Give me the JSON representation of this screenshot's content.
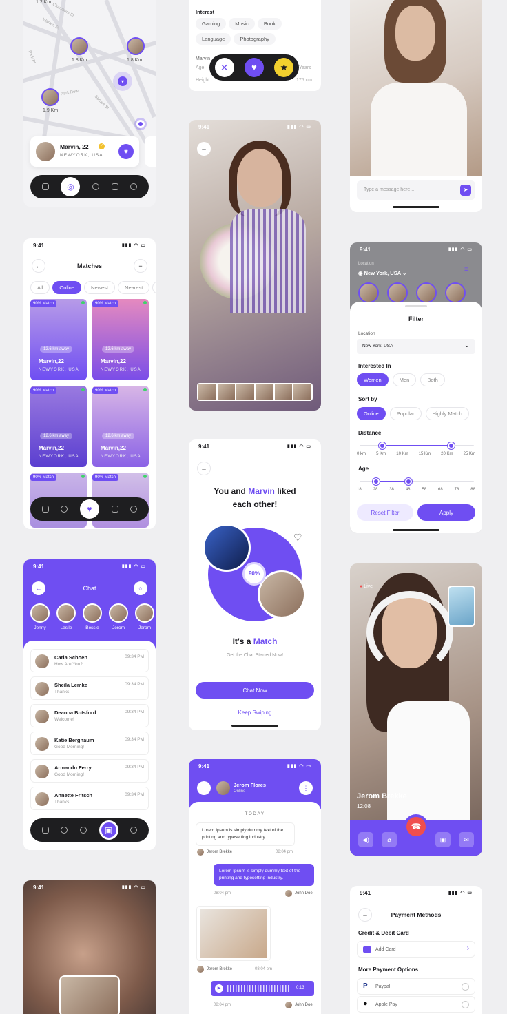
{
  "map": {
    "distances": [
      "1.2 Km",
      "1.8 Km",
      "1.8 Km",
      "1.9 Km"
    ],
    "streets": [
      "Chambers St",
      "Warren St",
      "Park Pl",
      "Park Row",
      "Spruce St"
    ],
    "profile": {
      "name": "Marvin, 22",
      "location": "NEWYORK, USA"
    }
  },
  "interest": {
    "heading": "Interest",
    "chips": [
      "Gaming",
      "Music",
      "Book",
      "Language",
      "Photography"
    ],
    "partial_labels": [
      "Marvin",
      "Age",
      "Height",
      "Years",
      "175 cm"
    ]
  },
  "message": {
    "placeholder": "Type a message here..."
  },
  "profile_photo": {
    "time": "9:41"
  },
  "matches": {
    "time": "9:41",
    "title": "Matches",
    "tabs": [
      "All",
      "Online",
      "Newest",
      "Nearest",
      "M"
    ],
    "match_badge": "90% Match",
    "distance": "12.6 km away",
    "cards": [
      {
        "name": "Marvin,22",
        "loc": "NEWYORK, USA"
      },
      {
        "name": "Marvin,22",
        "loc": "NEWYORK, USA"
      },
      {
        "name": "Marvin,22",
        "loc": "NEWYORK, USA"
      },
      {
        "name": "Marvin,22",
        "loc": "NEWYORK, USA"
      }
    ]
  },
  "filter": {
    "time": "9:41",
    "location_label": "Location",
    "location_value": "New York, USA",
    "title": "Filter",
    "location_field_label": "Location",
    "location_field_value": "New York, USA",
    "interested_label": "Interested In",
    "interested": [
      "Women",
      "Men",
      "Both"
    ],
    "sort_label": "Sort by",
    "sort": [
      "Online",
      "Popular",
      "Highly Match"
    ],
    "distance_label": "Distance",
    "distance_ticks": [
      "0 km",
      "5 Km",
      "10 Km",
      "15 Km",
      "20 Km",
      "25 Km"
    ],
    "distance_range": [
      5,
      20
    ],
    "age_label": "Age",
    "age_ticks": [
      "18",
      "28",
      "38",
      "48",
      "58",
      "68",
      "78",
      "88"
    ],
    "age_range": [
      28,
      48
    ],
    "reset": "Reset Filter",
    "apply": "Apply"
  },
  "liked": {
    "time": "9:41",
    "line1a": "You and ",
    "line1b": "Marvin",
    "line1c": " liked",
    "line2": "each other!",
    "percent": "90%",
    "match_a": "It's a ",
    "match_b": "Match",
    "subtitle": "Get the Chat Started Now!",
    "cta": "Chat Now",
    "keep": "Keep Swiping"
  },
  "chat": {
    "time": "9:41",
    "title": "Chat",
    "stories": [
      "Jenny",
      "Lesile",
      "Bessie",
      "Jerom",
      "Jerom"
    ],
    "rows": [
      {
        "name": "Carla Schoen",
        "msg": "How Are You?",
        "time": "09:34 PM"
      },
      {
        "name": "Sheila Lemke",
        "msg": "Thanks",
        "time": "09:34 PM"
      },
      {
        "name": "Deanna Botsford",
        "msg": "Welcome!",
        "time": "09:34 PM"
      },
      {
        "name": "Katie Bergnaum",
        "msg": "Good Morning!",
        "time": "09:34 PM"
      },
      {
        "name": "Armando Ferry",
        "msg": "Good Morning!",
        "time": "09:34 PM"
      },
      {
        "name": "Annette Fritsch",
        "msg": "Thanks!",
        "time": "09:34 PM"
      }
    ]
  },
  "call": {
    "live": "Live",
    "name": "Jerom Brekke",
    "duration": "12:08"
  },
  "conversation": {
    "time": "9:41",
    "name": "Jerom Flores",
    "status": "Online",
    "day": "TODAY",
    "msg1": "Lorem Ipsum is simply dummy text of the printing and typesetting industry.",
    "sender1": "Jerom Brekke",
    "time1": "08:04 pm",
    "msg2": "Lorem Ipsum is simply dummy text of the printing and typesetting industry.",
    "time2": "08:04 pm",
    "sender2": "John Doe",
    "sender3": "Jerom Brekke",
    "time3": "08:04 pm",
    "audio_len": "0:13",
    "time4": "08:04 pm",
    "sender4": "John Doe"
  },
  "blurcall": {
    "time": "9:41"
  },
  "payment": {
    "time": "9:41",
    "title": "Payment Methods",
    "cards_label": "Credit & Debit Card",
    "add_card": "Add Card",
    "more_label": "More Payment Options",
    "options": [
      "Paypal",
      "Apple Pay"
    ]
  },
  "colors": {
    "accent": "#6f4ef2",
    "dark": "#1e1e20",
    "call_red": "#f04e4e"
  }
}
